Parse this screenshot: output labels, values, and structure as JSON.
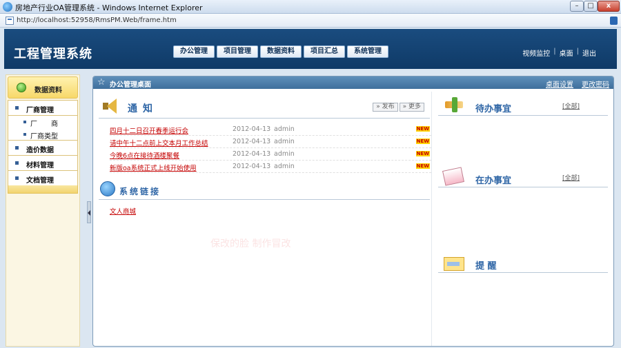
{
  "window": {
    "title": "房地产行业OA管理系统 - Windows Internet Explorer",
    "url": "http://localhost:52958/RmsPM.Web/frame.htm"
  },
  "header": {
    "logo": "工程管理系统",
    "nav": [
      "办公管理",
      "项目管理",
      "数据资料",
      "项目汇总",
      "系统管理"
    ],
    "links": [
      "视频监控",
      "桌面",
      "退出"
    ]
  },
  "sidebar": {
    "title": "数据资料",
    "items": [
      {
        "label": "厂商管理"
      },
      {
        "label": "厂　　商",
        "sub": true
      },
      {
        "label": "厂商类型",
        "sub": true
      },
      {
        "label": "造价数据"
      },
      {
        "label": "材料管理"
      },
      {
        "label": "文档管理"
      }
    ]
  },
  "main": {
    "title": "办公管理桌面",
    "header_links": [
      "桌面设置",
      "更改密码"
    ],
    "notice": {
      "title": "通知",
      "publish_label": "发布",
      "more_label": "更多",
      "items": [
        {
          "title": "四月十二日召开春季运行会",
          "date": "2012-04-13",
          "user": "admin",
          "badge": "NEW"
        },
        {
          "title": "请中午十二点前上交本月工作总结",
          "date": "2012-04-13",
          "user": "admin",
          "badge": "NEW"
        },
        {
          "title": "今晚6点在接待酒楼聚餐",
          "date": "2012-04-13",
          "user": "admin",
          "badge": "NEW"
        },
        {
          "title": "新版oa系统正式上线开始使用",
          "date": "2012-04-13",
          "user": "admin",
          "badge": "NEW"
        }
      ]
    },
    "links_section": {
      "title": "系统链接",
      "items": [
        "文人商城"
      ]
    },
    "watermark": "保改的脸 制作冒改",
    "right": {
      "todo": {
        "title": "待办事宜",
        "all": "[全部]"
      },
      "doing": {
        "title": "在办事宜",
        "all": "[全部]"
      },
      "remind": {
        "title": "提 醒"
      }
    }
  },
  "colors": {
    "header_bg": "#1a4c7f",
    "panel_head": "#4f80ad",
    "accent_text": "#2f66a6",
    "link_red": "#c40000",
    "sidebar_bg": "#fbf6e3"
  }
}
